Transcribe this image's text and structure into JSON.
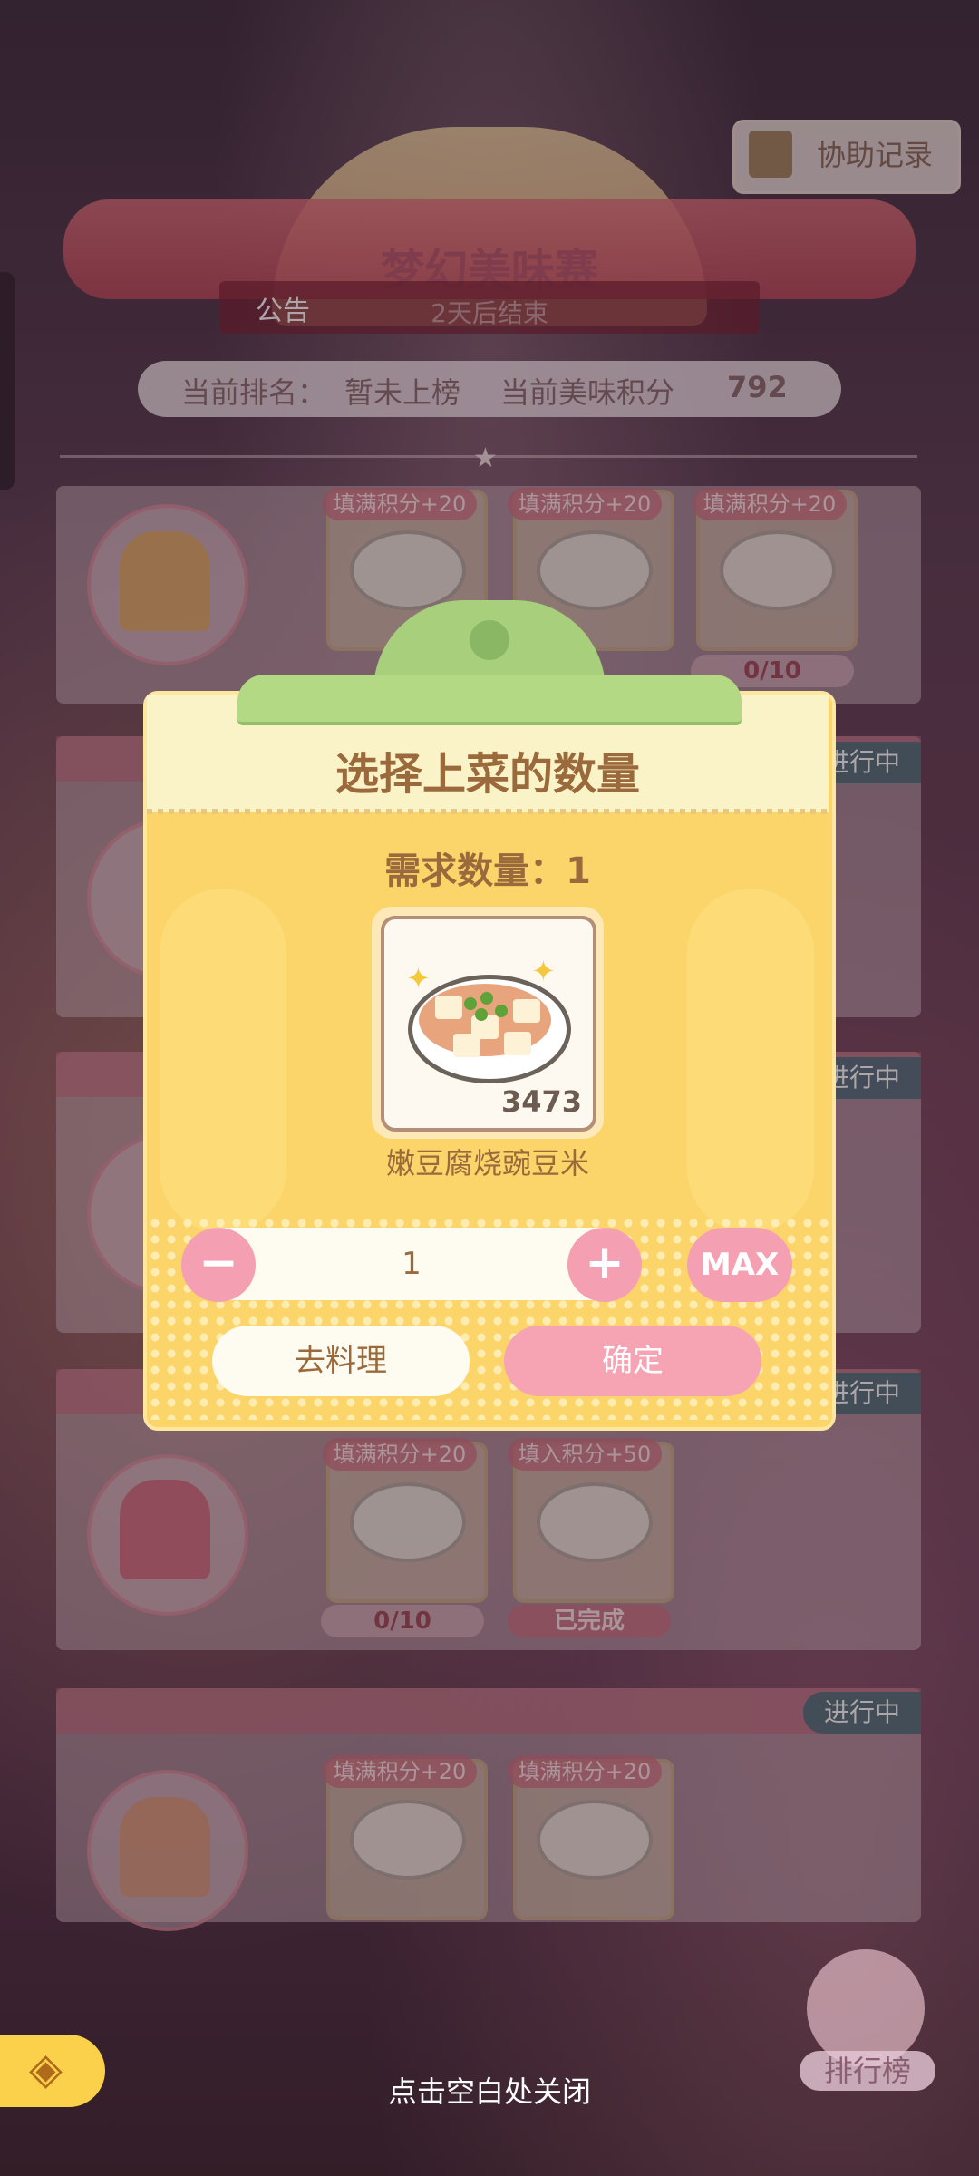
{
  "header": {
    "event_title": "梦幻美味赛",
    "notice_label": "公告",
    "ends_text": "2天后结束",
    "assist_label": "协助记录"
  },
  "rank_bar": {
    "rank_label": "当前排名：",
    "rank_value": "暂未上榜",
    "score_label": "当前美味积分",
    "score_value": "792"
  },
  "cards": {
    "card1": {
      "tags": [
        "填满积分+20",
        "填满积分+20",
        "填满积分+20"
      ],
      "progress": "0/10"
    },
    "card2": {
      "status": "进行中"
    },
    "card3": {
      "status": "进行中"
    },
    "card4": {
      "status": "进行中",
      "tags": [
        "填满积分+20",
        "填入积分+50"
      ],
      "progress": [
        "0/10",
        "已完成"
      ]
    },
    "card5": {
      "status": "进行中",
      "tags": [
        "填满积分+20",
        "填满积分+20"
      ]
    }
  },
  "modal": {
    "title": "选择上菜的数量",
    "required_label": "需求数量：1",
    "item_count": "3473",
    "item_name": "嫩豆腐烧豌豆米",
    "minus_label": "−",
    "plus_label": "+",
    "quantity": "1",
    "max_label": "MAX",
    "cook_label": "去料理",
    "confirm_label": "确定"
  },
  "footer": {
    "close_hint": "点击空白处关闭",
    "leaderboard_label": "排行榜",
    "back_icon": "back-arrow-icon"
  },
  "colors": {
    "modal_bg": "#fbd46a",
    "accent_pink": "#f5a0b2",
    "text_brown": "#9b6a3c",
    "status_teal": "#286e78"
  }
}
